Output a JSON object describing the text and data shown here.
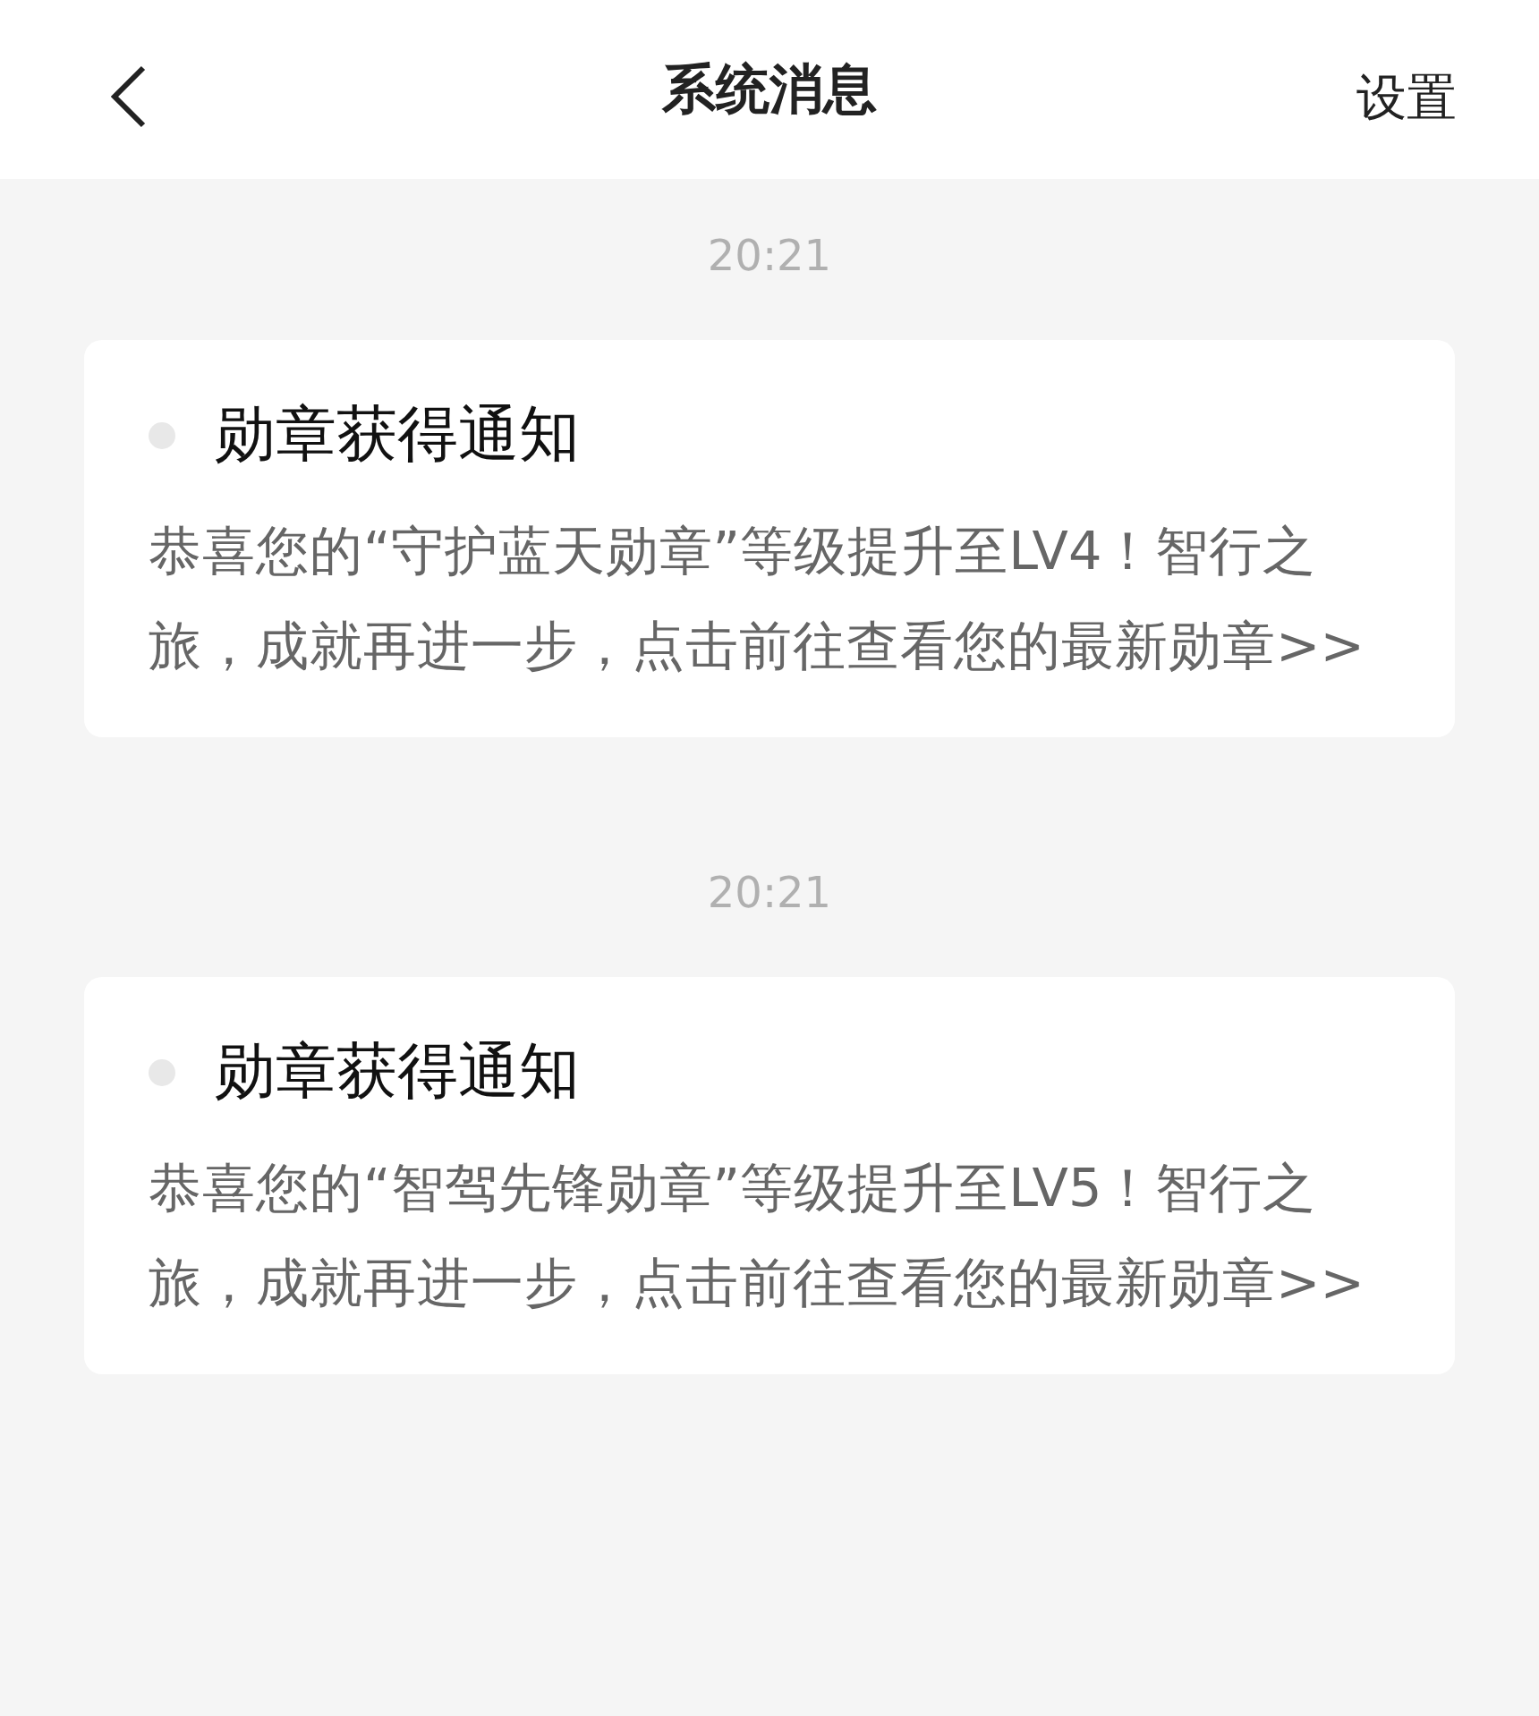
{
  "header": {
    "title": "系统消息",
    "action": "设置"
  },
  "messages": [
    {
      "time": "20:21",
      "title": "勋章获得通知",
      "body": "恭喜您的“守护蓝天勋章”等级提升至LV4！智行之旅，成就再进一步，点击前往查看您的最新勋章>>"
    },
    {
      "time": "20:21",
      "title": "勋章获得通知",
      "body": "恭喜您的“智驾先锋勋章”等级提升至LV5！智行之旅，成就再进一步，点击前往查看您的最新勋章>>"
    }
  ]
}
